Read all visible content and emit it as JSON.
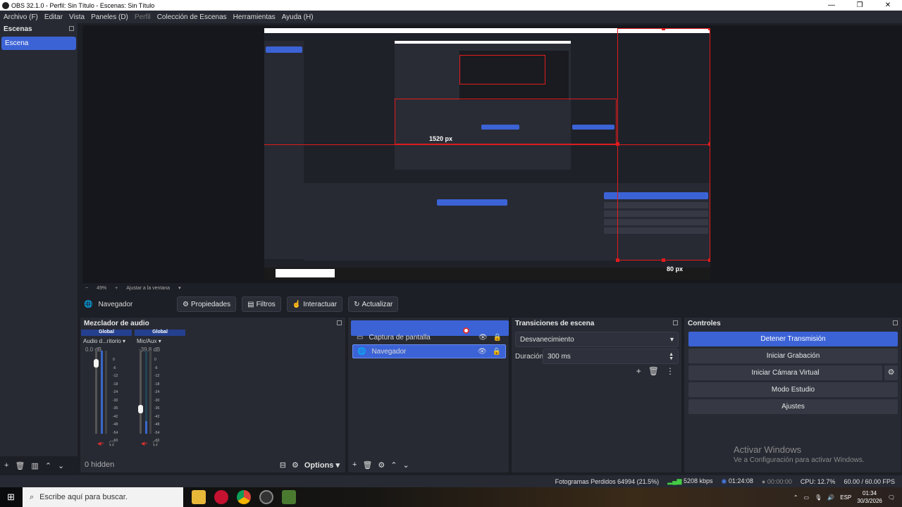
{
  "window": {
    "title": "OBS 32.1.0 - Perfil: Sin Título - Escenas: Sin Título",
    "min": "—",
    "max": "❐",
    "close": "✕"
  },
  "menu": [
    "Archivo (F)",
    "Editar",
    "Vista",
    "Paneles (D)",
    "Perfil",
    "Colección de Escenas",
    "Herramientas",
    "Ayuda (H)"
  ],
  "scenes": {
    "title": "Escenas",
    "items": [
      "Escena"
    ]
  },
  "preview": {
    "overlay_label": "1520 px",
    "overlay_label_small": "80 px",
    "zoom": "49%",
    "fit_label": "Ajustar a la ventana"
  },
  "context": {
    "source_name": "Navegador",
    "properties": "Propiedades",
    "filters": "Filtros",
    "interact": "Interactuar",
    "refresh": "Actualizar"
  },
  "mixer": {
    "title": "Mezclador de audio",
    "channels": [
      {
        "scope": "Global",
        "name": "Audio d...ritorio",
        "db": "0.0 dB",
        "level": 0.9
      },
      {
        "scope": "Global",
        "name": "Mic/Aux",
        "db": "-39.8 dB",
        "level": 0.35
      }
    ],
    "scale": [
      "0",
      "-6",
      "-12",
      "-18",
      "-24",
      "-30",
      "-36",
      "-42",
      "-48",
      "-54",
      "-60"
    ],
    "hidden": "0 hidden",
    "options": "Options"
  },
  "sources": {
    "items": [
      "Captura de pantalla",
      "Navegador"
    ]
  },
  "transitions": {
    "title": "Transiciones de escena",
    "type": "Desvanecimiento",
    "duration_label": "Duración",
    "duration": "300 ms"
  },
  "controls": {
    "title": "Controles",
    "buttons": [
      "Detener Transmisión",
      "Iniciar Grabación",
      "Iniciar Cámara Virtual",
      "Modo Estudio",
      "Ajustes"
    ]
  },
  "watermark": {
    "line1": "Activar Windows",
    "line2": "Ve a Configuración para activar Windows."
  },
  "status": {
    "dropped": "Fotogramas Perdidos 64994 (21.5%)",
    "bitrate": "5208 kbps",
    "stream_time": "01:24:08",
    "rec_time": "00:00:00",
    "cpu": "CPU: 12.7%",
    "fps": "60.00 / 60.00 FPS"
  },
  "taskbar": {
    "search_placeholder": "Escribe aquí para buscar.",
    "lang": "ESP",
    "time": "01:34",
    "date": "30/3/2026"
  },
  "colors": {
    "accent": "#3c63d6",
    "bg": "#1d1f26",
    "dock": "#272a33",
    "guide": "#e01c1c"
  }
}
